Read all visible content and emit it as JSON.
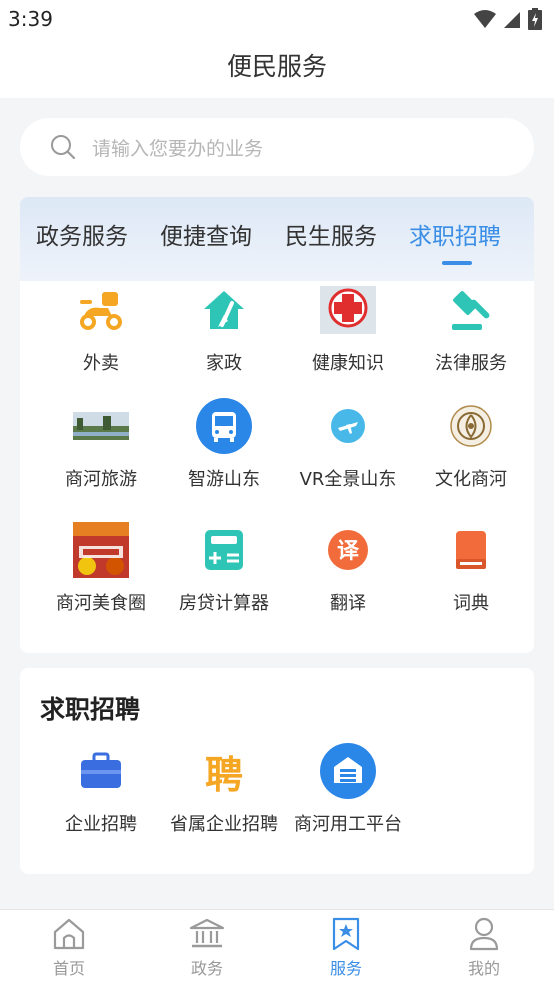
{
  "status_bar": {
    "time": "3:39"
  },
  "header": {
    "title": "便民服务"
  },
  "search": {
    "placeholder": "请输入您要办的业务"
  },
  "tabs": [
    {
      "label": "政务服务",
      "active": false
    },
    {
      "label": "便捷查询",
      "active": false
    },
    {
      "label": "民生服务",
      "active": false
    },
    {
      "label": "求职招聘",
      "active": true
    }
  ],
  "services": [
    {
      "label": "外卖",
      "icon": "scooter-icon"
    },
    {
      "label": "家政",
      "icon": "house-broom-icon"
    },
    {
      "label": "健康知识",
      "icon": "red-cross-icon"
    },
    {
      "label": "法律服务",
      "icon": "gavel-icon"
    },
    {
      "label": "商河旅游",
      "icon": "landscape-photo-icon"
    },
    {
      "label": "智游山东",
      "icon": "bus-icon"
    },
    {
      "label": "VR全景山东",
      "icon": "plane-globe-icon"
    },
    {
      "label": "文化商河",
      "icon": "seal-emblem-icon"
    },
    {
      "label": "商河美食圈",
      "icon": "food-photo-icon"
    },
    {
      "label": "房贷计算器",
      "icon": "calculator-icon"
    },
    {
      "label": "翻译",
      "icon": "translate-icon"
    },
    {
      "label": "词典",
      "icon": "book-icon"
    }
  ],
  "jobs_section": {
    "title": "求职招聘",
    "items": [
      {
        "label": "企业招聘",
        "icon": "briefcase-icon"
      },
      {
        "label": "省属企业招聘",
        "icon": "pin-character-icon",
        "glyph": "聘"
      },
      {
        "label": "商河用工平台",
        "icon": "building-icon"
      }
    ]
  },
  "bottom_nav": [
    {
      "label": "首页",
      "icon": "home-icon",
      "active": false
    },
    {
      "label": "政务",
      "icon": "government-icon",
      "active": false
    },
    {
      "label": "服务",
      "icon": "bookmark-star-icon",
      "active": true
    },
    {
      "label": "我的",
      "icon": "person-icon",
      "active": false
    }
  ],
  "colors": {
    "accent": "#3a8ee6",
    "food_orange": "#f5a623",
    "house_teal": "#2ec4b6",
    "cross_red": "#e02d2d",
    "bus_blue": "#2a87e8",
    "translate_orange": "#f26b3a"
  },
  "icon_glyphs": {
    "translate": "译"
  }
}
